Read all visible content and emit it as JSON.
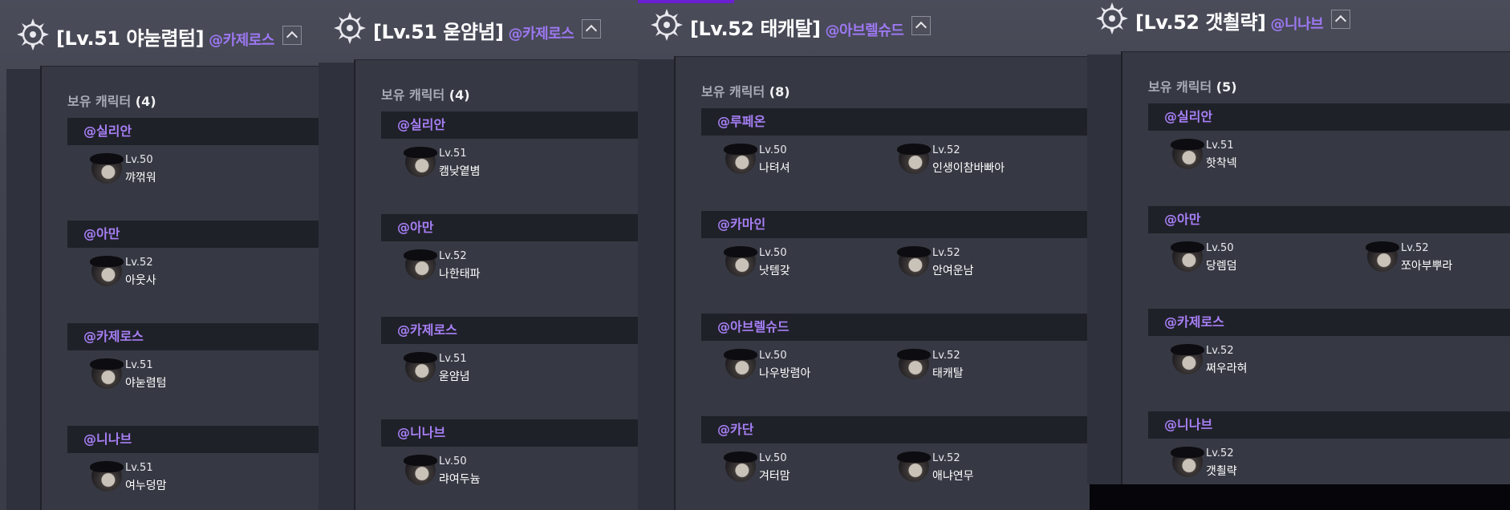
{
  "owned_label": "보유 캐릭터",
  "panels": [
    {
      "title": "[Lv.51 야눋렴텀]",
      "server": "@카제로스",
      "count": "(4)",
      "groups": [
        {
          "server": "@실리안",
          "chars": [
            {
              "level": "Lv.50",
              "name": "꺄꺾워"
            }
          ]
        },
        {
          "server": "@아만",
          "chars": [
            {
              "level": "Lv.52",
              "name": "아웃사"
            }
          ]
        },
        {
          "server": "@카제로스",
          "chars": [
            {
              "level": "Lv.51",
              "name": "야눋렴텀"
            }
          ]
        },
        {
          "server": "@니나브",
          "chars": [
            {
              "level": "Lv.51",
              "name": "여누덩맘"
            }
          ]
        }
      ]
    },
    {
      "title": "[Lv.51 욷얌념]",
      "server": "@카제로스",
      "count": "(4)",
      "groups": [
        {
          "server": "@실리안",
          "chars": [
            {
              "level": "Lv.51",
              "name": "캠낮옅볌"
            }
          ]
        },
        {
          "server": "@아만",
          "chars": [
            {
              "level": "Lv.52",
              "name": "나한태파"
            }
          ]
        },
        {
          "server": "@카제로스",
          "chars": [
            {
              "level": "Lv.51",
              "name": "욷얌념"
            }
          ]
        },
        {
          "server": "@니나브",
          "chars": [
            {
              "level": "Lv.50",
              "name": "랴여두늄"
            }
          ]
        }
      ]
    },
    {
      "title": "[Lv.52 태캐탈]",
      "server": "@아브렐슈드",
      "count": "(8)",
      "groups": [
        {
          "server": "@루페온",
          "chars": [
            {
              "level": "Lv.50",
              "name": "나텨셔"
            },
            {
              "level": "Lv.52",
              "name": "인생이참바빠아"
            }
          ]
        },
        {
          "server": "@카마인",
          "chars": [
            {
              "level": "Lv.50",
              "name": "낫템갖"
            },
            {
              "level": "Lv.52",
              "name": "안여운남"
            }
          ]
        },
        {
          "server": "@아브렐슈드",
          "chars": [
            {
              "level": "Lv.50",
              "name": "나우방렴아"
            },
            {
              "level": "Lv.52",
              "name": "태캐탈"
            }
          ]
        },
        {
          "server": "@카단",
          "chars": [
            {
              "level": "Lv.50",
              "name": "겨터맘"
            },
            {
              "level": "Lv.52",
              "name": "애냐연무"
            }
          ]
        }
      ]
    },
    {
      "title": "[Lv.52 갯쵤략]",
      "server": "@니나브",
      "count": "(5)",
      "groups": [
        {
          "server": "@실리안",
          "chars": [
            {
              "level": "Lv.51",
              "name": "핫착넥"
            }
          ]
        },
        {
          "server": "@아만",
          "chars": [
            {
              "level": "Lv.50",
              "name": "당렘덤"
            },
            {
              "level": "Lv.52",
              "name": "쪼아부뿌라"
            }
          ]
        },
        {
          "server": "@카제로스",
          "chars": [
            {
              "level": "Lv.52",
              "name": "쩌우라혀"
            }
          ]
        },
        {
          "server": "@니나브",
          "chars": [
            {
              "level": "Lv.52",
              "name": "갯쵤략"
            }
          ]
        }
      ]
    }
  ]
}
